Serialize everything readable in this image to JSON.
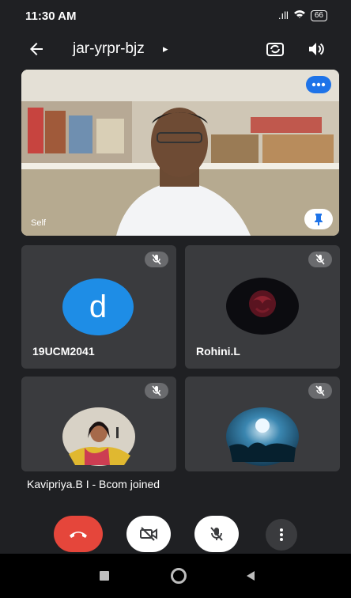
{
  "status_bar": {
    "time": "11:30 AM",
    "signal": ".ıll",
    "battery": "66"
  },
  "meeting": {
    "code": "jar-yrpr-bjz",
    "code_arrow": "▸"
  },
  "presenter": {
    "name_label": "Self"
  },
  "participants": [
    {
      "name": "19UCM2041",
      "avatar_letter": "d",
      "muted": true
    },
    {
      "name": "Rohini.L",
      "muted": true
    },
    {
      "name": "",
      "muted": true
    },
    {
      "name": "",
      "muted": true
    }
  ],
  "toast": {
    "text": "Kavipriya.B I - Bcom joined"
  },
  "colors": {
    "accent": "#1e8de6",
    "end_call": "#e5463b",
    "background": "#1f2023",
    "tile": "#3a3b3e"
  },
  "icons": [
    "back-arrow-icon",
    "camera-switch-icon",
    "speaker-icon",
    "more-options-icon",
    "pin-icon",
    "mic-off-icon",
    "end-call-icon",
    "video-off-icon",
    "mic-off-icon",
    "more-vertical-icon"
  ]
}
